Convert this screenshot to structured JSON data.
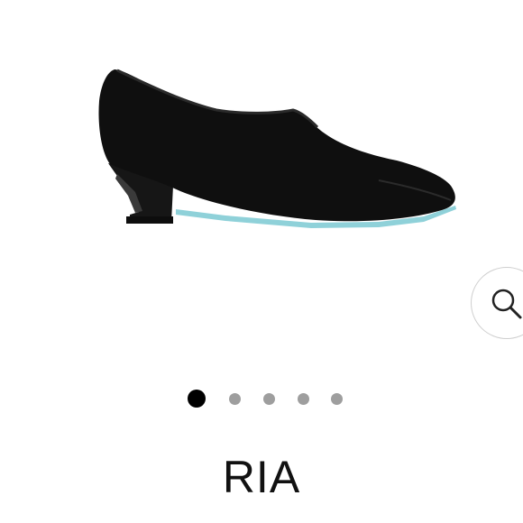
{
  "product": {
    "name": "RIA",
    "image_description_icon": "black-pump-shoe-image"
  },
  "gallery": {
    "dots": [
      {
        "active": true
      },
      {
        "active": false
      },
      {
        "active": false
      },
      {
        "active": false
      },
      {
        "active": false
      }
    ],
    "active_dot_color": "#000000",
    "inactive_dot_color": "#9e9e9e"
  },
  "zoom": {
    "icon": "magnifier-icon"
  }
}
